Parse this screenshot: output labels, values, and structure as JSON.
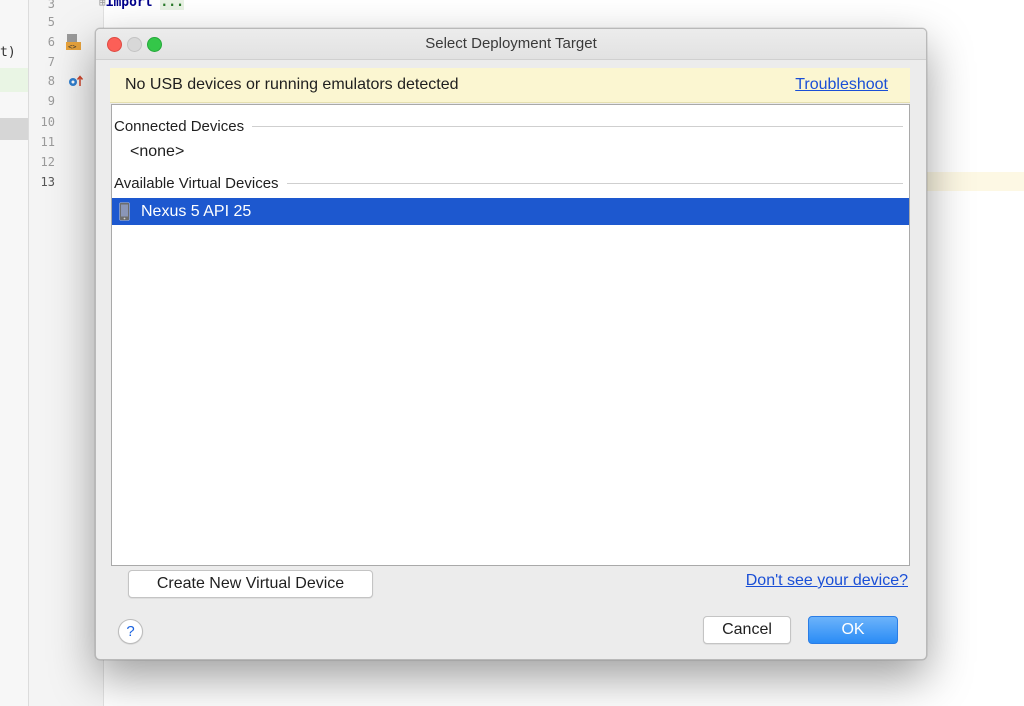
{
  "ide": {
    "left_edge_text": "t)",
    "line_numbers": [
      "3",
      "5",
      "6",
      "7",
      "8",
      "9",
      "10",
      "11",
      "12",
      "13"
    ],
    "code": {
      "keyword": "import",
      "folded": "..."
    }
  },
  "dialog": {
    "title": "Select Deployment Target",
    "warning": {
      "text": "No USB devices or running emulators detected",
      "link": "Troubleshoot"
    },
    "sections": {
      "connected": {
        "header": "Connected Devices",
        "empty_text": "<none>"
      },
      "available": {
        "header": "Available Virtual Devices",
        "devices": [
          {
            "name": "Nexus 5 API 25",
            "selected": true,
            "icon": "phone-icon"
          }
        ]
      }
    },
    "buttons": {
      "create": "Create New Virtual Device",
      "dont_see": "Don't see your device?",
      "help": "?",
      "cancel": "Cancel",
      "ok": "OK"
    }
  },
  "colors": {
    "selection": "#1d58cf",
    "link": "#1a4fd6",
    "banner": "#fbf6d1",
    "ok_button": "#2a8cf6"
  }
}
